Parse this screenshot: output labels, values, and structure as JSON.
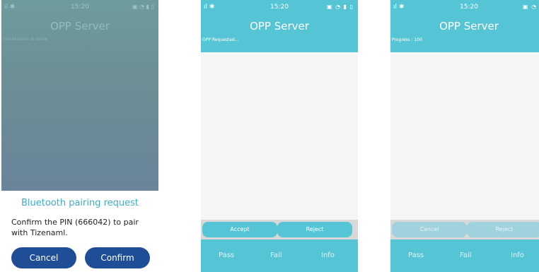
{
  "phone1": {
    "status_time": "15:20",
    "status_signal": "ıl ✱",
    "status_right": "▣ ◔ ▮ ▯",
    "title": "OPP Server",
    "subtitle": "Visualization & mode",
    "dialog": {
      "title": "Bluetooth pairing request",
      "text": "Confirm the PIN (666042) to pair with Tizenaml.",
      "cancel_label": "Cancel",
      "confirm_label": "Confirm"
    }
  },
  "phone2": {
    "status_time": "15:20",
    "status_signal": "ıl ✱",
    "status_right": "▣ ◔ ▮ ▯",
    "title": "OPP Server",
    "subtitle": "OPP Requested...",
    "accept_label": "Accept",
    "reject_label": "Reject",
    "pass_label": "Pass",
    "fail_label": "Fail",
    "info_label": "Info"
  },
  "phone3": {
    "status_time": "15:20",
    "status_signal": "ıl ✱",
    "status_right": "▣ ◔ ▮",
    "title": "OPP Server",
    "subtitle": "Progress : 100",
    "cancel_label": "Cancel",
    "reject_label": "Reject",
    "pass_label": "Pass",
    "fail_label": "Fail",
    "info_label": "Info"
  },
  "colors": {
    "accent": "#55c5d5",
    "dialog_button": "#1f4e96",
    "dialog_title": "#3dadc6"
  },
  "icons": [
    "signal-icon",
    "bluetooth-icon",
    "battery-icon",
    "wifi-icon"
  ]
}
